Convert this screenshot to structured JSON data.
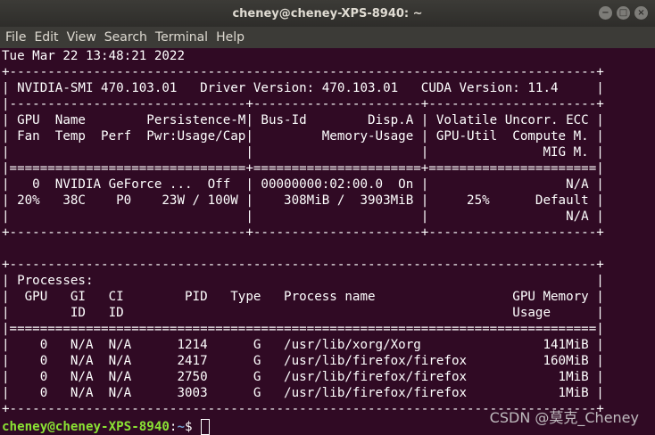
{
  "window": {
    "title": "cheney@cheney-XPS-8940: ~",
    "controls": {
      "minimize": "−",
      "maximize": "□",
      "close": "×"
    }
  },
  "menubar": {
    "items": [
      "File",
      "Edit",
      "View",
      "Search",
      "Terminal",
      "Help"
    ]
  },
  "terminal": {
    "lines": [
      "Tue Mar 22 13:48:21 2022",
      "+-----------------------------------------------------------------------------+",
      "| NVIDIA-SMI 470.103.01   Driver Version: 470.103.01   CUDA Version: 11.4     |",
      "|-------------------------------+----------------------+----------------------+",
      "| GPU  Name        Persistence-M| Bus-Id        Disp.A | Volatile Uncorr. ECC |",
      "| Fan  Temp  Perf  Pwr:Usage/Cap|         Memory-Usage | GPU-Util  Compute M. |",
      "|                               |                      |               MIG M. |",
      "|===============================+======================+======================|",
      "|   0  NVIDIA GeForce ...  Off  | 00000000:02:00.0  On |                  N/A |",
      "| 20%   38C    P0    23W / 100W |    308MiB /  3903MiB |     25%      Default |",
      "|                               |                      |                  N/A |",
      "+-------------------------------+----------------------+----------------------+",
      "",
      "+-----------------------------------------------------------------------------+",
      "| Processes:                                                                  |",
      "|  GPU   GI   CI        PID   Type   Process name                  GPU Memory |",
      "|        ID   ID                                                   Usage      |",
      "|=============================================================================|",
      "|    0   N/A  N/A      1214      G   /usr/lib/xorg/Xorg                141MiB |",
      "|    0   N/A  N/A      2417      G   /usr/lib/firefox/firefox          160MiB |",
      "|    0   N/A  N/A      2750      G   /usr/lib/firefox/firefox            1MiB |",
      "|    0   N/A  N/A      3003      G   /usr/lib/firefox/firefox            1MiB |",
      "+-----------------------------------------------------------------------------+"
    ],
    "prompt": {
      "user_host": "cheney@cheney-XPS-8940",
      "separator": ":",
      "path": "~",
      "symbol": "$ "
    }
  },
  "watermark": "CSDN @莫克_Cheney",
  "colors": {
    "terminal_bg": "#300a24",
    "prompt_user": "#8ae234",
    "prompt_path": "#729fcf",
    "titlebar": "#3c3b37"
  }
}
